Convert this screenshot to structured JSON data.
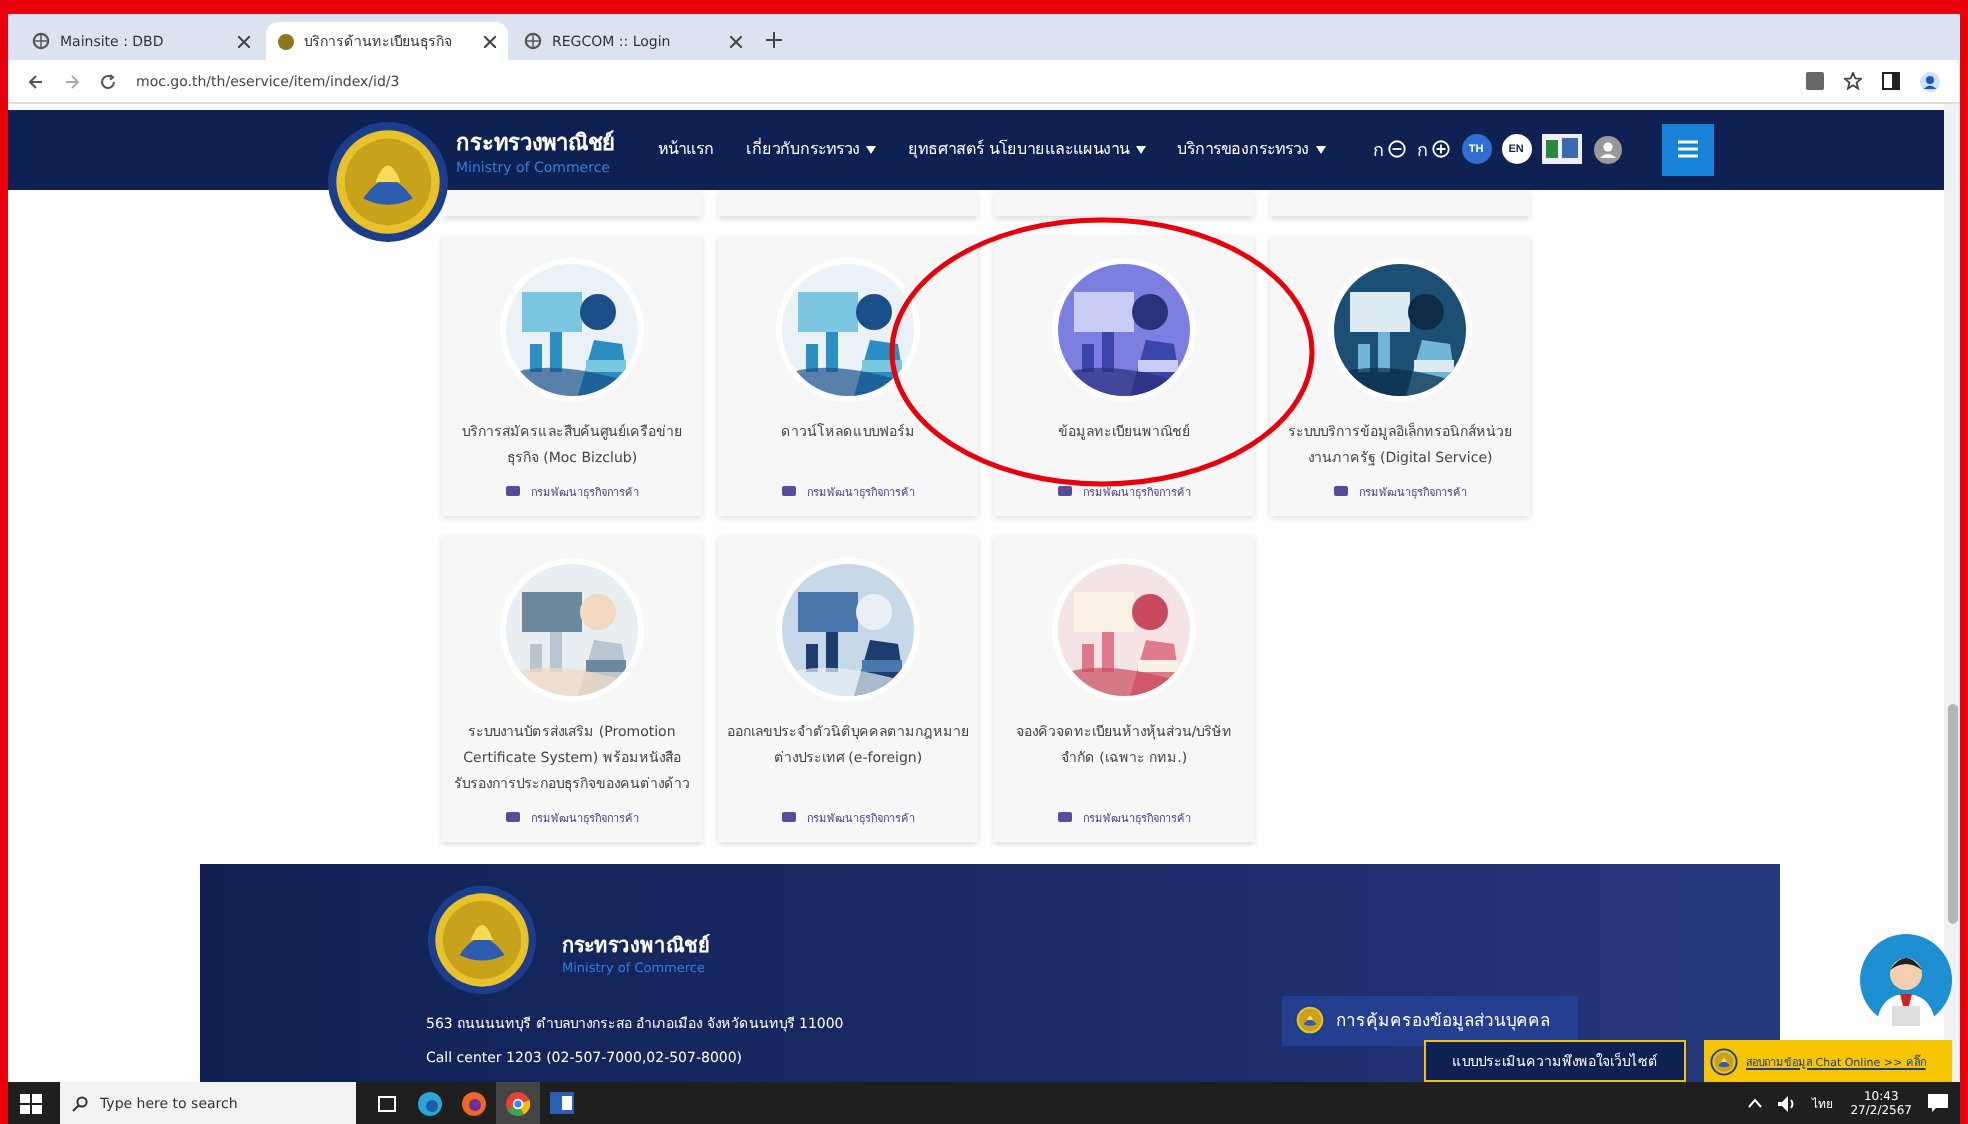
{
  "browser": {
    "tabs": [
      {
        "title": "Mainsite : DBD",
        "selected": false
      },
      {
        "title": "บริการด้านทะเบียนธุรกิจ",
        "selected": true
      },
      {
        "title": "REGCOM :: Login",
        "selected": false
      }
    ],
    "url": "moc.go.th/th/eservice/item/index/id/3"
  },
  "header": {
    "title": "กระทรวงพาณิชย์",
    "subtitle": "Ministry of Commerce",
    "nav": [
      {
        "label": "หน้าแรก",
        "dropdown": false
      },
      {
        "label": "เกี่ยวกับกระทรวง",
        "dropdown": true
      },
      {
        "label": "ยุทธศาสตร์ นโยบายและแผนงาน",
        "dropdown": true
      },
      {
        "label": "บริการของกระทรวง",
        "dropdown": true
      }
    ],
    "font_smaller": "ก",
    "font_larger": "ก",
    "languages": [
      {
        "code": "TH",
        "selected": true
      },
      {
        "code": "EN",
        "selected": false
      }
    ]
  },
  "cards": [
    {
      "title": "บริการสมัครและสืบค้นศูนย์เครือข่ายธุรกิจ (Moc Bizclub)",
      "department": "กรมพัฒนาธุรกิจการค้า"
    },
    {
      "title": "ดาวน์โหลดแบบฟอร์ม",
      "department": "กรมพัฒนาธุรกิจการค้า"
    },
    {
      "title": "ข้อมูลทะเบียนพาณิชย์",
      "department": "กรมพัฒนาธุรกิจการค้า"
    },
    {
      "title": "ระบบบริการข้อมูลอิเล็กทรอนิกส์หน่วยงานภาครัฐ (Digital Service)",
      "department": "กรมพัฒนาธุรกิจการค้า"
    },
    {
      "title": "ระบบงานบัตรส่งเสริม (Promotion Certificate System) พร้อมหนังสือรับรองการประกอบธุรกิจของคนต่างด้าว",
      "department": "กรมพัฒนาธุรกิจการค้า"
    },
    {
      "title": "ออกเลขประจำตัวนิติบุคคลตามกฎหมายต่างประเทศ (e-foreign)",
      "department": "กรมพัฒนาธุรกิจการค้า"
    },
    {
      "title": "จองคิวจดทะเบียนห้างหุ้นส่วน/บริษัทจำกัด (เฉพาะ กทม.)",
      "department": "กรมพัฒนาธุรกิจการค้า"
    }
  ],
  "footer": {
    "title": "กระทรวงพาณิชย์",
    "subtitle": "Ministry of Commerce",
    "address": "563 ถนนนนทบุรี ตำบลบางกระสอ อำเภอเมือง จังหวัดนนทบุรี 11000",
    "call_center": "Call center 1203 (02-507-7000,02-507-8000)",
    "privacy": "การคุ้มครองข้อมูลส่วนบุคคล",
    "survey": "แบบประเมินความพึงพอใจเว็บไซต์",
    "chat": "สอบถามข้อมูล Chat Online >> คลิ๊ก"
  },
  "taskbar": {
    "search_placeholder": "Type here to search",
    "time": "10:43",
    "date": "27/2/2567",
    "language": "ไทย"
  }
}
